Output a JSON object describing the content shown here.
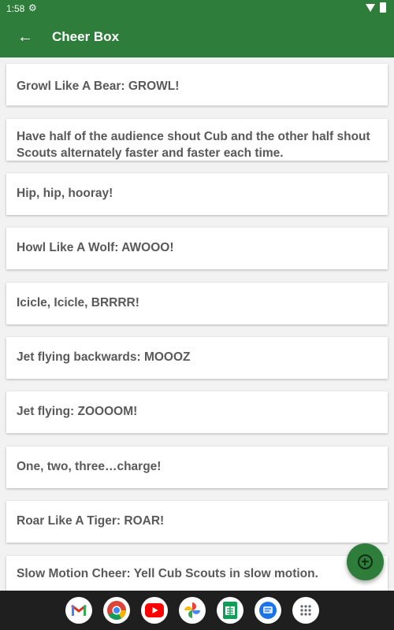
{
  "status_bar": {
    "time": "1:58"
  },
  "app_bar": {
    "title": "Cheer Box",
    "back_icon": "arrow-left-icon"
  },
  "cheers": [
    "Growl Like A Bear: GROWL!",
    "Have half of the audience shout Cub and the other half shout Scouts alternately faster and faster each time.",
    "Hip, hip, hooray!",
    "Howl Like A Wolf: AWOOO!",
    "Icicle, Icicle, BRRRR!",
    "Jet flying backwards: MOOOZ",
    "Jet flying: ZOOOOM!",
    "One, two, three…charge!",
    "Roar Like A Tiger: ROAR!",
    "Slow Motion Cheer: Yell Cub Scouts in slow motion."
  ],
  "fab": {
    "icon": "add-circle-icon"
  },
  "dock": [
    "gmail-icon",
    "chrome-icon",
    "youtube-icon",
    "photos-icon",
    "sheets-icon",
    "messages-icon",
    "app-drawer-icon"
  ],
  "colors": {
    "primary": "#2e7d3a",
    "text": "#595959",
    "background": "#f2f2f2"
  }
}
